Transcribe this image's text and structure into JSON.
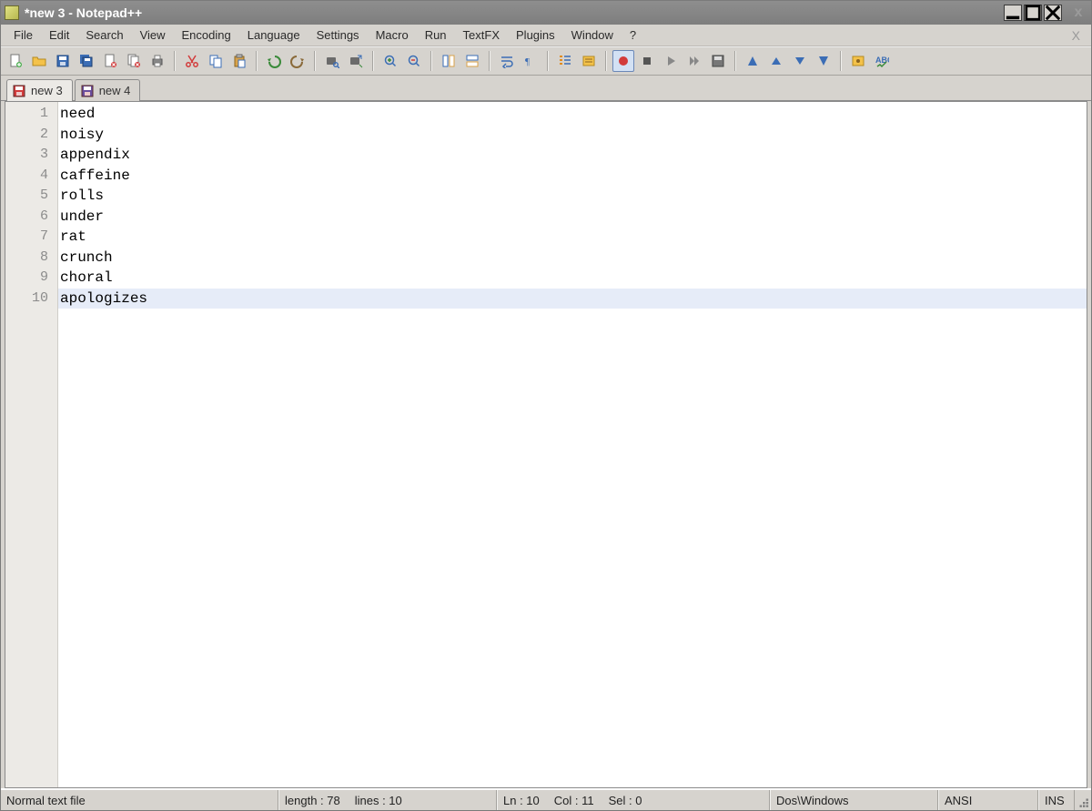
{
  "title": "*new 3 - Notepad++",
  "menu": [
    "File",
    "Edit",
    "Search",
    "View",
    "Encoding",
    "Language",
    "Settings",
    "Macro",
    "Run",
    "TextFX",
    "Plugins",
    "Window",
    "?"
  ],
  "toolbar_icons": [
    "new-file-icon",
    "open-file-icon",
    "save-icon",
    "save-all-icon",
    "close-file-icon",
    "close-all-icon",
    "print-icon",
    "sep",
    "cut-icon",
    "copy-icon",
    "paste-icon",
    "sep",
    "undo-icon",
    "redo-icon",
    "sep",
    "find-icon",
    "replace-icon",
    "sep",
    "zoom-in-icon",
    "zoom-out-icon",
    "sep",
    "sync-v-icon",
    "sync-h-icon",
    "sep",
    "wordwrap-icon",
    "show-all-icon",
    "sep",
    "indent-guide-icon",
    "user-lang-icon",
    "sep",
    "record-macro-icon",
    "stop-macro-icon",
    "play-macro-icon",
    "fast-macro-icon",
    "save-macro-icon",
    "sep",
    "tri-left-icon",
    "tri-up-icon",
    "tri-down-icon",
    "tri-right-icon",
    "sep",
    "settings-icon",
    "spellcheck-icon"
  ],
  "toolbar_active_index": 22,
  "tabs": [
    {
      "label": "new 3",
      "color": "#d23b3b",
      "active": true
    },
    {
      "label": "new 4",
      "color": "#6a4d9e",
      "active": false
    }
  ],
  "editor": {
    "lines": [
      "need",
      "noisy",
      "appendix",
      "caffeine",
      "rolls",
      "under",
      "rat",
      "crunch",
      "choral",
      "apologizes"
    ],
    "current_line_index": 9
  },
  "status": {
    "file_type": "Normal text file",
    "length_label": "length : 78",
    "lines_label": "lines : 10",
    "ln_label": "Ln : 10",
    "col_label": "Col : 11",
    "sel_label": "Sel : 0",
    "eol": "Dos\\Windows",
    "encoding": "ANSI",
    "mode": "INS"
  }
}
